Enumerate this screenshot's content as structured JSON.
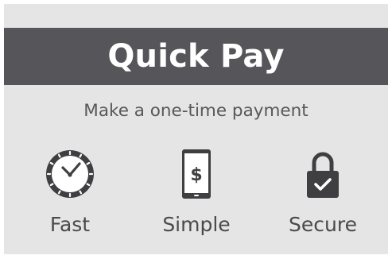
{
  "header": {
    "title": "Quick Pay"
  },
  "tagline": "Make a one-time payment",
  "features": [
    {
      "label": "Fast",
      "icon": "clock-icon"
    },
    {
      "label": "Simple",
      "icon": "phone-dollar-icon"
    },
    {
      "label": "Secure",
      "icon": "lock-check-icon"
    }
  ],
  "phone_symbol": "$",
  "colors": {
    "banner_bg": "#56565a",
    "card_bg": "#e4e5e4",
    "text": "#4f4f52",
    "icon": "#3f3f42"
  }
}
